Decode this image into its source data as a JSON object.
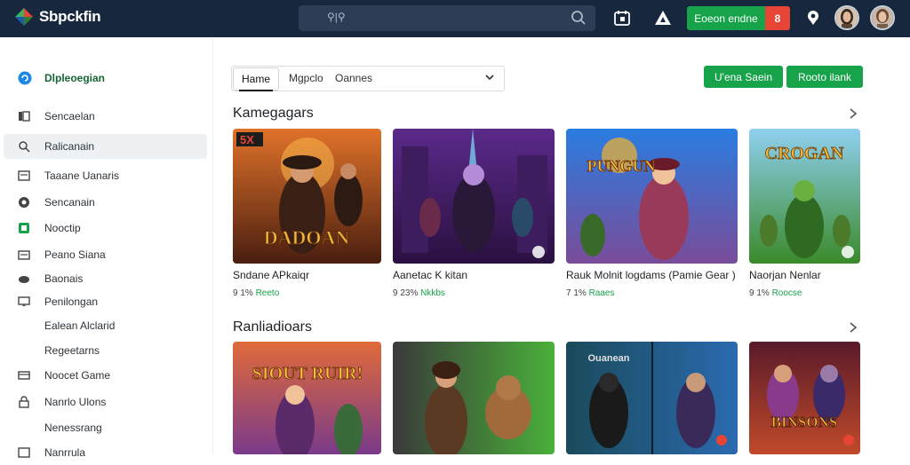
{
  "app": {
    "name": "Sbpckfin"
  },
  "search": {
    "text": "⚲|⚲"
  },
  "top_actions": {
    "primary_label": "Eoeon endne",
    "badge_label": "8"
  },
  "sidebar": {
    "header": "Dlpleoegian",
    "items": [
      {
        "label": "Sencaelan",
        "icon": "library-icon"
      },
      {
        "label": "Ralicanain",
        "icon": "search-icon",
        "active": true
      },
      {
        "label": "Taaane Uanaris",
        "icon": "list-icon"
      },
      {
        "label": "Sencanain",
        "icon": "gamepad-icon"
      },
      {
        "label": "Nooctip",
        "icon": "green-square-icon"
      },
      {
        "label": "Peano Siana",
        "icon": "card-icon"
      },
      {
        "label": "Baonais",
        "icon": "controller-icon"
      },
      {
        "label": "Penilongan",
        "icon": "monitor-icon"
      },
      {
        "label": "Ealean Alclarid",
        "icon": ""
      },
      {
        "label": "Regeetarns",
        "icon": ""
      },
      {
        "label": "Noocet Game",
        "icon": "store-icon"
      },
      {
        "label": "Nanrlo Ulons",
        "icon": "lock-icon"
      },
      {
        "label": "Nenessrang",
        "icon": ""
      },
      {
        "label": "Nanrrula",
        "icon": "grid-icon"
      }
    ]
  },
  "tabs": {
    "home": "Hame",
    "filter1": "Mgpclo",
    "filter2": "Oannes"
  },
  "header_buttons": {
    "btn1": "U'ena Saein",
    "btn2": "Rooto ilank"
  },
  "section1": {
    "title": "Kamegagars",
    "cards": [
      {
        "title": "Sndane APkaiqr",
        "price": "9 1%",
        "tag": "Reeto",
        "art_text": "DADOAN",
        "badge": "5X"
      },
      {
        "title": "Aanetac K kitan",
        "price": "9 23%",
        "tag": "Nkkbs",
        "art_text": ""
      },
      {
        "title": "Rauk Molnit logdams (Pamie Gear )",
        "price": "7 1%",
        "tag": "Raaes",
        "art_text": "PUNGUN"
      },
      {
        "title": "Naorjan Nenlar",
        "price": "9 1%",
        "tag": "Roocse",
        "art_text": "CROGAN"
      }
    ]
  },
  "section2": {
    "title": "Ranliadioars",
    "cards": [
      {
        "art_text": "SIOUT RUIR!"
      },
      {
        "art_text": ""
      },
      {
        "art_text": "Ouanean"
      },
      {
        "art_text": "BINSONS"
      }
    ]
  },
  "colors": {
    "topbar": "#17273d",
    "accent": "#16a34a",
    "badge_red": "#e64535"
  }
}
